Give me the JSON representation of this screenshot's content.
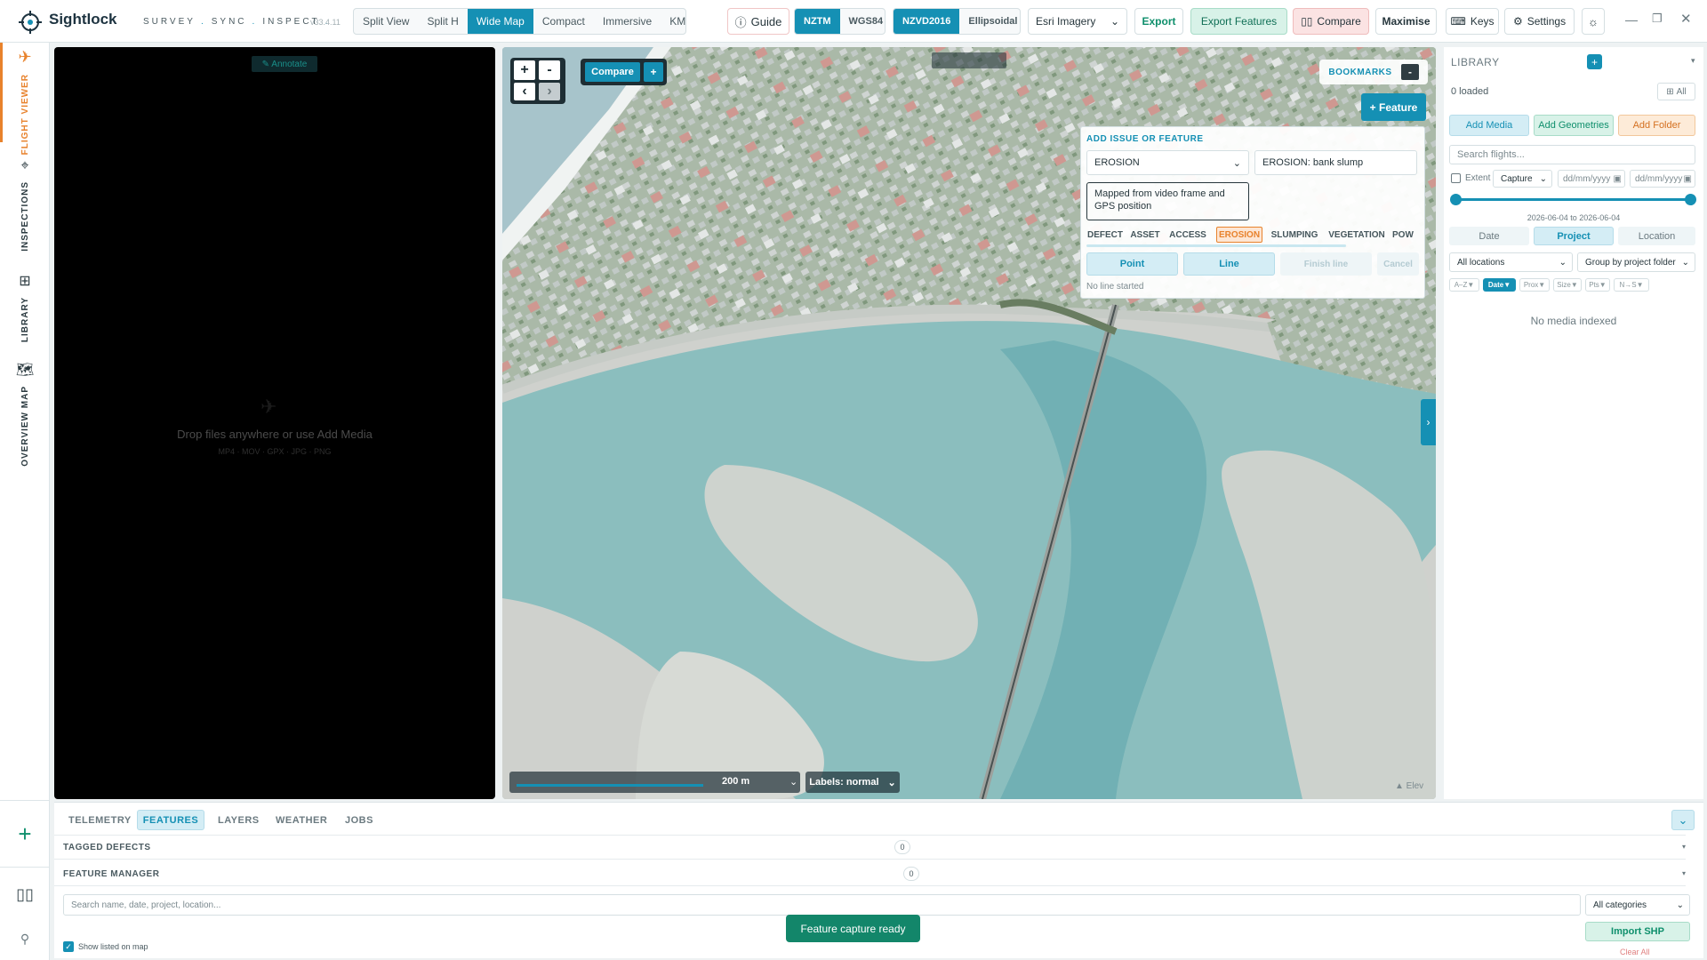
{
  "app": {
    "name": "Sightlock",
    "tagline_parts": [
      "SURVEY",
      "SYNC",
      "INSPECT"
    ],
    "version": "v33.4.11"
  },
  "views": [
    {
      "label": "Split View",
      "active": false
    },
    {
      "label": "Split H",
      "active": false
    },
    {
      "label": "Wide Map",
      "active": true
    },
    {
      "label": "Compact",
      "active": false
    },
    {
      "label": "Immersive",
      "active": false
    },
    {
      "label": "KML In",
      "active": false
    }
  ],
  "toolbar": {
    "guide": "Guide",
    "crs": [
      {
        "label": "NZTM",
        "active": true
      },
      {
        "label": "WGS84",
        "active": false
      }
    ],
    "vdatum": [
      {
        "label": "NZVD2016",
        "active": true
      },
      {
        "label": "Ellipsoidal",
        "active": false
      }
    ],
    "basemap": "Esri Imagery",
    "export": "Export",
    "export_features": "Export Features",
    "compare": "Compare",
    "maximise": "Maximise",
    "keys": "Keys",
    "settings": "Settings"
  },
  "rail": {
    "tabs": [
      "FLIGHT VIEWER",
      "INSPECTIONS",
      "LIBRARY",
      "OVERVIEW MAP"
    ]
  },
  "video": {
    "annotate": "✎ Annotate",
    "drop_text": "Drop files anywhere or use Add Media",
    "formats": "MP4 · MOV · GPX · JPG · PNG"
  },
  "map": {
    "zoom_in": "+",
    "zoom_out": "-",
    "prev": "‹",
    "next": "›",
    "compare": "Compare",
    "compare_add": "+",
    "bookmarks": "BOOKMARKS",
    "bookmarks_toggle": "-",
    "feature_btn": "+ Feature",
    "scale": "200 m",
    "labels": "Labels: normal",
    "elev": "▲ Elev"
  },
  "feature_panel": {
    "title": "ADD ISSUE OR FEATURE",
    "category": "EROSION",
    "name_value": "EROSION: bank slump",
    "notes": "Mapped from video frame and GPS position",
    "chips": [
      {
        "label": "DEFECT",
        "active": false
      },
      {
        "label": "ASSET",
        "active": false
      },
      {
        "label": "ACCESS",
        "active": false
      },
      {
        "label": "EROSION",
        "active": true
      },
      {
        "label": "SLUMPING",
        "active": false
      },
      {
        "label": "VEGETATION",
        "active": false
      },
      {
        "label": "POW",
        "active": false
      }
    ],
    "point": "Point",
    "line": "Line",
    "finish": "Finish line",
    "cancel": "Cancel",
    "status": "No line started"
  },
  "library": {
    "title": "LIBRARY",
    "add": "+",
    "loaded": "0 loaded",
    "all": "All",
    "add_media": "Add Media",
    "add_geometries": "Add Geometries",
    "add_folder": "Add Folder",
    "search_placeholder": "Search flights...",
    "extent": "Extent",
    "capture": "Capture",
    "date_placeholder": "dd/mm/yyyy",
    "range": "2026-06-04 to 2026-06-04",
    "group_tabs": [
      {
        "label": "Date",
        "active": false
      },
      {
        "label": "Project",
        "active": true
      },
      {
        "label": "Location",
        "active": false
      }
    ],
    "locations": "All locations",
    "group_by": "Group by project folder",
    "sorts": [
      {
        "label": "A–Z▼",
        "active": false
      },
      {
        "label": "Date▼",
        "active": true
      },
      {
        "label": "Prox▼",
        "active": false
      },
      {
        "label": "Size▼",
        "active": false
      },
      {
        "label": "Pts▼",
        "active": false
      },
      {
        "label": "N→S▼",
        "active": false
      }
    ],
    "empty": "No media indexed"
  },
  "bottom": {
    "tabs": [
      {
        "label": "TELEMETRY",
        "active": false
      },
      {
        "label": "FEATURES",
        "active": true
      },
      {
        "label": "LAYERS",
        "active": false
      },
      {
        "label": "WEATHER",
        "active": false
      },
      {
        "label": "JOBS",
        "active": false
      }
    ],
    "sections": [
      {
        "label": "TAGGED DEFECTS",
        "count": "0"
      },
      {
        "label": "FEATURE MANAGER",
        "count": "0"
      }
    ],
    "search_placeholder": "Search name, date, project, location...",
    "categories": "All categories",
    "toast": "Feature capture ready",
    "import_shp": "Import SHP",
    "clear_all": "Clear All",
    "show_listed": "Show listed on map"
  },
  "colors": {
    "accent": "#1590b4",
    "green": "#0f8f6c",
    "orange": "#e8822c",
    "map_water": "#6fb3b3"
  }
}
